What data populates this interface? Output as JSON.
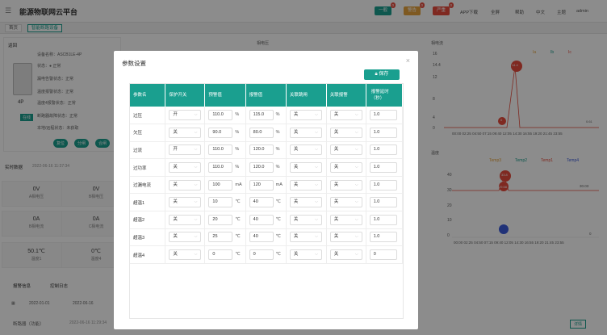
{
  "header": {
    "title": "能源物联网云平台",
    "badges": [
      {
        "label": "一般",
        "count": "0",
        "color": "#1a9f8f"
      },
      {
        "label": "警告",
        "count": "0",
        "color": "#e6a23c"
      },
      {
        "label": "严重",
        "count": "0",
        "color": "#e74c3c"
      }
    ],
    "items": [
      "APP下载",
      "全屏",
      "帮助",
      "中文",
      "主题",
      "admin"
    ]
  },
  "tabs": [
    "首页",
    "智能断路设备"
  ],
  "device": {
    "back_label": "返回",
    "fields": [
      "设备名称：ASCB1LE-4P",
      "状态：● 正常",
      "漏电告警状态：正常",
      "温度报警状态：正常",
      "温度4报警状态：正常",
      "断路器故障状态：正常",
      "本地/远程状态：未获取"
    ],
    "model": "4P",
    "online_label": "在线",
    "actions": [
      "复位",
      "分闸",
      "合闸"
    ]
  },
  "realtime": {
    "title": "实时数据",
    "timestamp": "2022-06-16 11:37:34",
    "stats": [
      {
        "value": "0V",
        "label": "A相电压"
      },
      {
        "value": "0V",
        "label": "B相电压"
      },
      {
        "value": "0A",
        "label": "B相电流"
      },
      {
        "value": "0A",
        "label": "C相电流"
      },
      {
        "value": "50.1℃",
        "label": "温度1"
      },
      {
        "value": "0℃",
        "label": "温度4"
      }
    ]
  },
  "bottom": {
    "tabs": [
      "报警信息",
      "控制日志"
    ],
    "date_start": "2022-01-01",
    "date_end": "2022-06-16",
    "event": "断路器（功能）",
    "event_time": "2022-06-16 11:29:34",
    "detail_label": "详情"
  },
  "bg_charts": {
    "left_title": "相电压",
    "right_title": "相电流",
    "temp_title": "温度",
    "current_legend": [
      "Ia",
      "Ib",
      "Ic"
    ],
    "temp_legend": [
      "Temp3",
      "Temp2",
      "Temp1",
      "Temp4"
    ],
    "y_labels_current": [
      "16",
      "14.4",
      "12",
      "8",
      "4",
      "0"
    ],
    "y_labels_temp": [
      "40",
      "30",
      "20",
      "10",
      "0"
    ],
    "x_labels": [
      "00:00",
      "02:25",
      "04:50",
      "07:15",
      "09:40",
      "12:05",
      "14:30",
      "16:55",
      "19:20",
      "21:45",
      "23:55"
    ],
    "markers_current": [
      "14.4",
      "0",
      "0.61"
    ],
    "markers_temp": [
      "33.8",
      "29.58",
      "30.03",
      "0"
    ]
  },
  "modal": {
    "title": "参数设置",
    "save_label": "保存",
    "columns": [
      "参数名",
      "保护开关",
      "预警值",
      "报警值",
      "关联跳闸",
      "关联报警",
      "报警延时（秒）"
    ],
    "rows": [
      {
        "name": "过压",
        "protect": "开",
        "warn": "110.0",
        "warn_unit": "%",
        "alarm": "115.0",
        "alarm_unit": "%",
        "trip": "关",
        "alert": "关",
        "delay": "1.0"
      },
      {
        "name": "欠压",
        "protect": "关",
        "warn": "90.0",
        "warn_unit": "%",
        "alarm": "80.0",
        "alarm_unit": "%",
        "trip": "关",
        "alert": "关",
        "delay": "1.0"
      },
      {
        "name": "过流",
        "protect": "开",
        "warn": "110.0",
        "warn_unit": "%",
        "alarm": "120.0",
        "alarm_unit": "%",
        "trip": "关",
        "alert": "关",
        "delay": "1.0"
      },
      {
        "name": "过功率",
        "protect": "关",
        "warn": "110.0",
        "warn_unit": "%",
        "alarm": "120.0",
        "alarm_unit": "%",
        "trip": "关",
        "alert": "关",
        "delay": "1.0"
      },
      {
        "name": "过漏电流",
        "protect": "关",
        "warn": "100",
        "warn_unit": "mA",
        "alarm": "120",
        "alarm_unit": "mA",
        "trip": "关",
        "alert": "关",
        "delay": "1.0"
      },
      {
        "name": "超温1",
        "protect": "关",
        "warn": "10",
        "warn_unit": "℃",
        "alarm": "40",
        "alarm_unit": "℃",
        "trip": "关",
        "alert": "关",
        "delay": "1.0"
      },
      {
        "name": "超温2",
        "protect": "关",
        "warn": "20",
        "warn_unit": "℃",
        "alarm": "40",
        "alarm_unit": "℃",
        "trip": "关",
        "alert": "关",
        "delay": "1.0"
      },
      {
        "name": "超温3",
        "protect": "关",
        "warn": "25",
        "warn_unit": "℃",
        "alarm": "40",
        "alarm_unit": "℃",
        "trip": "关",
        "alert": "关",
        "delay": "1.0"
      },
      {
        "name": "超温4",
        "protect": "关",
        "warn": "0",
        "warn_unit": "℃",
        "alarm": "0",
        "alarm_unit": "℃",
        "trip": "关",
        "alert": "关",
        "delay": "0"
      }
    ]
  }
}
